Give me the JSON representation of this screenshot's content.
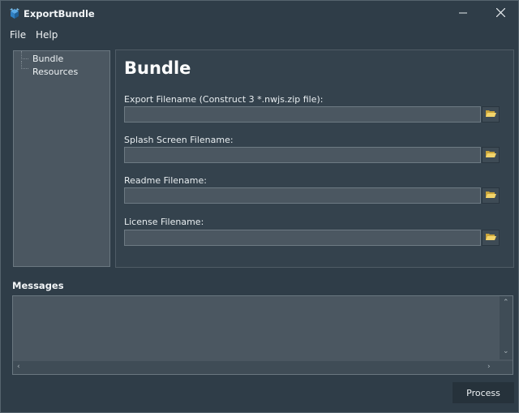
{
  "window": {
    "title": "ExportBundle"
  },
  "menu": [
    "File",
    "Help"
  ],
  "tree": {
    "items": [
      "Bundle",
      "Resources"
    ]
  },
  "panel": {
    "title": "Bundle",
    "fields": [
      {
        "label": "Export Filename (Construct 3 *.nwjs.zip file):",
        "value": ""
      },
      {
        "label": "Splash Screen Filename:",
        "value": ""
      },
      {
        "label": "Readme Filename:",
        "value": ""
      },
      {
        "label": "License Filename:",
        "value": ""
      }
    ]
  },
  "messages": {
    "label": "Messages",
    "content": ""
  },
  "actions": {
    "process_label": "Process"
  },
  "icons": {
    "app": "box-icon",
    "browse": "folder-open-icon",
    "minimize": "minimize-icon",
    "close": "close-icon"
  },
  "colors": {
    "window_bg": "#2f3d48",
    "field_bg": "#4b5761",
    "process_bg": "#26323b"
  }
}
